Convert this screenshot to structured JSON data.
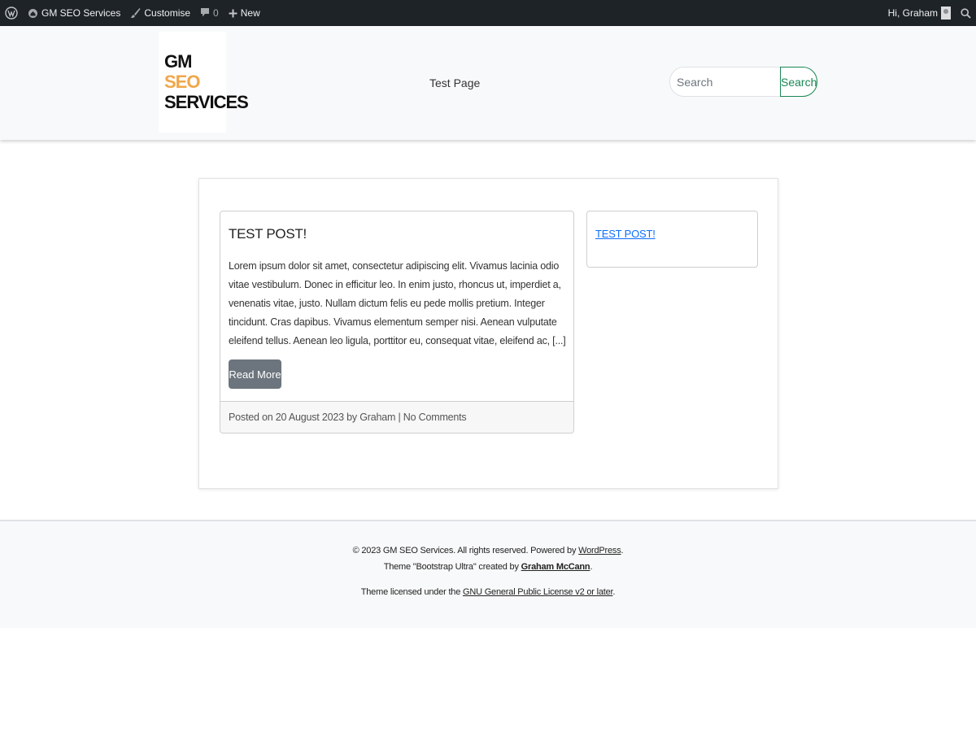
{
  "admin_bar": {
    "site_name": "GM SEO Services",
    "customise": "Customise",
    "comments_count": "0",
    "new": "New",
    "greeting": "Hi, Graham"
  },
  "header": {
    "logo": {
      "line1": "GM",
      "line2": "SEO",
      "line3": "SERVICES"
    },
    "nav_link": "Test Page",
    "search_placeholder": "Search",
    "search_button": "Search"
  },
  "post": {
    "title": "TEST POST!",
    "excerpt": "Lorem ipsum dolor sit amet, consectetur adipiscing elit. Vivamus lacinia odio vitae vestibulum. Donec in efficitur leo. In enim justo, rhoncus ut, imperdiet a, venenatis vitae, justo. Nullam dictum felis eu pede mollis pretium. Integer tincidunt. Cras dapibus. Vivamus elementum semper nisi. Aenean vulputate eleifend tellus. Aenean leo ligula, porttitor eu, consequat vitae, eleifend ac, [...]",
    "read_more": "Read More",
    "meta_prefix": "Posted on ",
    "date": "20 August 2023",
    "by": " by ",
    "author": "Graham",
    "separator": " | ",
    "comments": "No Comments"
  },
  "sidebar": {
    "recent_post": "TEST POST!"
  },
  "footer": {
    "line1_text": "© 2023 GM SEO Services. All rights reserved. Powered by ",
    "line1_link": "WordPress",
    "line1_end": ".",
    "line2_text": "Theme \"Bootstrap Ultra\" created by ",
    "line2_link": "Graham McCann",
    "line2_end": ".",
    "line3_text": "Theme licensed under the ",
    "line3_link": "GNU General Public License v2 or later",
    "line3_end": "."
  },
  "colors": {
    "admin_bar_bg": "#1d2327",
    "logo_accent": "#f0a74a",
    "search_button": "#198754",
    "read_more_bg": "#6c757d",
    "link_blue": "#0d6efd"
  }
}
